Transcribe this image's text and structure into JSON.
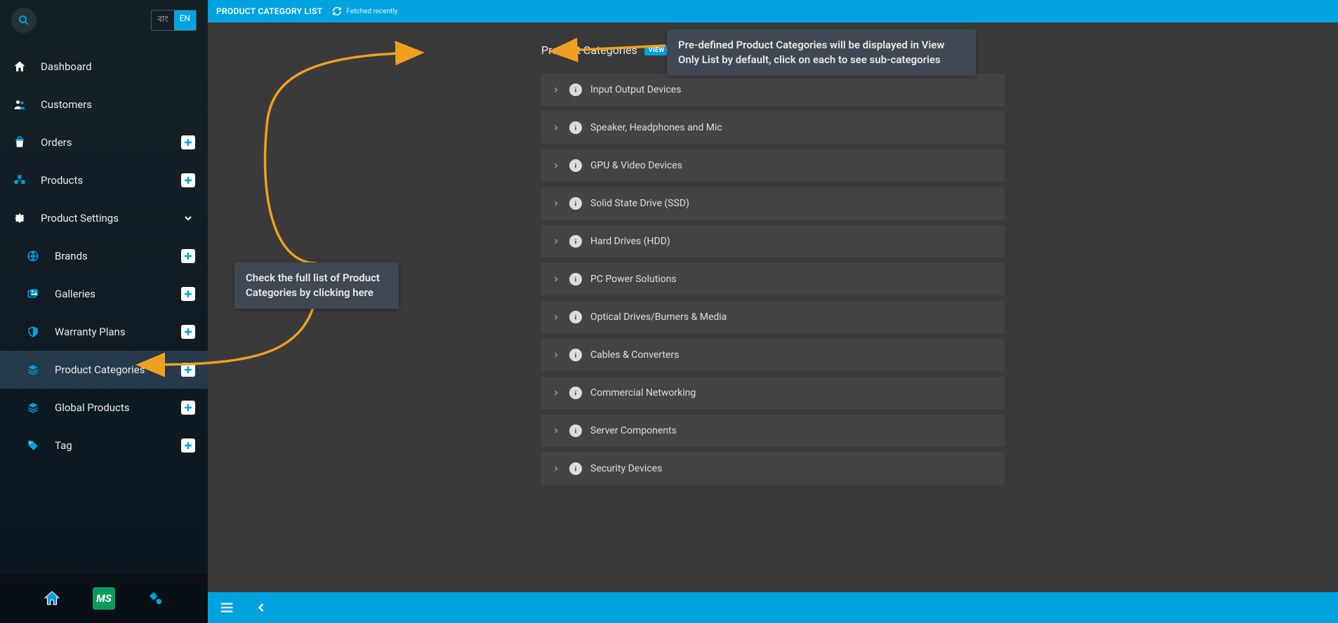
{
  "lang": {
    "bn": "বাং",
    "en": "EN"
  },
  "sidebar": {
    "items": [
      {
        "label": "Dashboard"
      },
      {
        "label": "Customers"
      },
      {
        "label": "Orders"
      },
      {
        "label": "Products"
      },
      {
        "label": "Product Settings"
      }
    ],
    "subitems": [
      {
        "label": "Brands"
      },
      {
        "label": "Galleries"
      },
      {
        "label": "Warranty Plans"
      },
      {
        "label": "Product Categories"
      },
      {
        "label": "Global Products"
      },
      {
        "label": "Tag"
      }
    ],
    "ms": "MS"
  },
  "topbar": {
    "title": "PRODUCT CATEGORY LIST",
    "fetched": "Fetched recently"
  },
  "heading": {
    "text": "Product Categories",
    "badge": "VIEW ONLY"
  },
  "categories": [
    {
      "name": "Input Output Devices"
    },
    {
      "name": "Speaker, Headphones and Mic"
    },
    {
      "name": "GPU & Video Devices"
    },
    {
      "name": "Solid State Drive (SSD)"
    },
    {
      "name": "Hard Drives (HDD)"
    },
    {
      "name": "PC Power Solutions"
    },
    {
      "name": "Optical Drives/Burners & Media"
    },
    {
      "name": "Cables & Converters"
    },
    {
      "name": "Commercial Networking"
    },
    {
      "name": "Server Components"
    },
    {
      "name": "Security Devices"
    }
  ],
  "annotations": {
    "left": "Check the full list of Product Categories by clicking here",
    "right": "Pre-defined Product Categories will be displayed in View Only List by default, click on each to see sub-categories"
  },
  "colors": {
    "accent": "#00a3e0",
    "arrow": "#f0a020"
  }
}
